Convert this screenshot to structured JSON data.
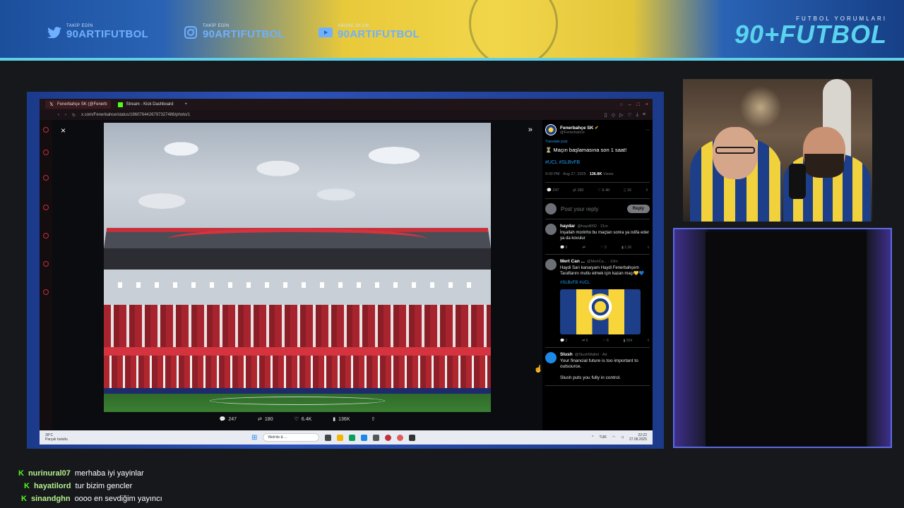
{
  "banner": {
    "socials": [
      {
        "icon": "twitter-icon",
        "small": "TAKİP EDİN",
        "handle": "90ARTIFUTBOL"
      },
      {
        "icon": "instagram-icon",
        "small": "TAKİP EDİN",
        "handle": "90ARTIFUTBOL"
      },
      {
        "icon": "youtube-icon",
        "small": "ABONE OLUN",
        "handle": "90ARTIFUTBOL"
      }
    ],
    "brand_tag": "FUTBOL YORUMLARI",
    "brand_logo": "90+FUTBOL"
  },
  "browser": {
    "tabs": [
      {
        "label": "Fenerbahçe SK (@Fenerb",
        "active": true
      },
      {
        "label": "Stream - Kick Dashboard",
        "active": false
      }
    ],
    "new_tab": "+",
    "url": "x.com/Fenerbahce/status/1960764426797327486/photo/1"
  },
  "viewer": {
    "close": "×",
    "expand": "»",
    "metrics": {
      "replies": "247",
      "retweets": "180",
      "likes": "6.4K",
      "views": "136K"
    }
  },
  "tweet": {
    "name": "Fenerbahçe SK",
    "handle": "@Fenerbahce",
    "translate": "Translate post",
    "text": "⏳ Maçın başlamasına son 1 saat!",
    "tags": "#UCL #SLBvFB",
    "time": "9:00 PM · Aug 27, 2025 ·",
    "views": "136.8K",
    "views_label": "Views",
    "actions": {
      "replies": "247",
      "retweets": "180",
      "likes": "6.4K",
      "bookmarks": "16"
    },
    "reply_placeholder": "Post your reply",
    "reply_button": "Reply"
  },
  "replies": [
    {
      "name": "haydar",
      "handle": "@haydi092 · 21m",
      "text": "İnşallah morinho bu maçtan sonra ya istifa eder ya da kovulur",
      "actions": [
        "6",
        "",
        "2",
        "1.1K"
      ]
    },
    {
      "name": "Mert Can ...",
      "handle": "@MertCa... · 10m",
      "text": "Haydi Sarı kanaryam Haydi Fenerbahçem Taraftarını mutlu etmek için kazan maçı💛💙",
      "tags": "#SLBvFB #UCL",
      "actions": [
        "1",
        "6",
        "6",
        "204"
      ]
    },
    {
      "name": "Slush",
      "handle": "@SlushWallet · Ad",
      "text": "Your financial future is too important to outsource.",
      "text2": "Slush puts you fully in control."
    }
  ],
  "taskbar": {
    "weather_temp": "28°C",
    "weather_desc": "Parçalı bulutlu",
    "search": "Web'de & ...",
    "lang": "TUR",
    "time": "22:22",
    "date": "27.08.2025"
  },
  "chat": [
    {
      "user": "nurinural07",
      "message": "merhaba iyi yayinlar"
    },
    {
      "user": "hayatilord",
      "message": "tur bizim gencler"
    },
    {
      "user": "sinandghn",
      "message": "oooo en sevdiğim yayıncı"
    }
  ],
  "colors": {
    "accent_blue": "#1d9bf0",
    "kick_green": "#53fc18",
    "fb_yellow": "#f7d53b",
    "fb_navy": "#1d3f8a"
  }
}
